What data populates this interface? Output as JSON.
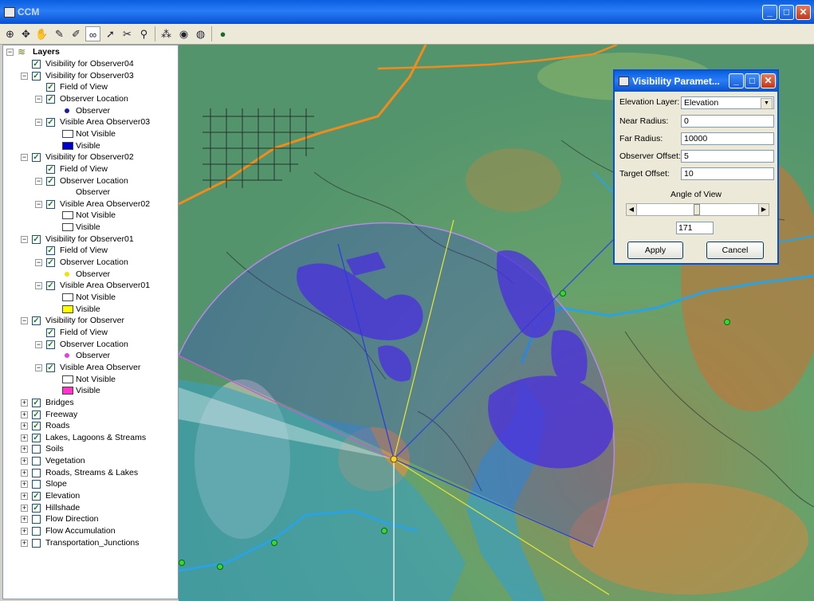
{
  "window": {
    "title": "CCM"
  },
  "toolbar": {
    "icons": [
      "zoom-in-icon",
      "pan-icon",
      "hand-icon",
      "identify-icon",
      "measure-icon",
      "binoculars-icon",
      "arrow-tool-icon",
      "select-tool-icon",
      "observer-icon",
      "network-icon",
      "globe-map-icon",
      "globe-edit-icon",
      "world-icon"
    ]
  },
  "layers": {
    "root": "Layers",
    "rows": [
      {
        "label": "Visibility for Observer04"
      },
      {
        "label": "Visibility for Observer03"
      },
      {
        "label": "Field of View"
      },
      {
        "label": "Observer Location"
      },
      {
        "label": "Observer",
        "color": "#1a1aa8"
      },
      {
        "label": "Visible Area Observer03"
      },
      {
        "label": "Not Visible"
      },
      {
        "label": "Visible",
        "color": "#0000cc"
      },
      {
        "label": "Visibility for Observer02"
      },
      {
        "label": "Field of View"
      },
      {
        "label": "Observer Location"
      },
      {
        "label": "Observer"
      },
      {
        "label": "Visible Area Observer02"
      },
      {
        "label": "Not Visible"
      },
      {
        "label": "Visible"
      },
      {
        "label": "Visibility for Observer01"
      },
      {
        "label": "Field of View"
      },
      {
        "label": "Observer Location"
      },
      {
        "label": "Observer",
        "color": "#f5e000"
      },
      {
        "label": "Visible Area Observer01"
      },
      {
        "label": "Not Visible"
      },
      {
        "label": "Visible",
        "color": "#ffff00"
      },
      {
        "label": "Visibility for Observer"
      },
      {
        "label": "Field of View"
      },
      {
        "label": "Observer Location"
      },
      {
        "label": "Observer",
        "color": "#e040e0"
      },
      {
        "label": "Visible Area Observer"
      },
      {
        "label": "Not Visible"
      },
      {
        "label": "Visible",
        "color": "#ff33cc"
      },
      {
        "label": "Bridges"
      },
      {
        "label": "Freeway"
      },
      {
        "label": "Roads"
      },
      {
        "label": "Lakes, Lagoons & Streams"
      },
      {
        "label": "Soils"
      },
      {
        "label": "Vegetation"
      },
      {
        "label": "Roads, Streams & Lakes"
      },
      {
        "label": "Slope"
      },
      {
        "label": "Elevation"
      },
      {
        "label": "Hillshade"
      },
      {
        "label": "Flow Direction"
      },
      {
        "label": "Flow Accumulation"
      },
      {
        "label": "Transportation_Junctions"
      }
    ]
  },
  "dialog": {
    "title": "Visibility Paramet...",
    "elevation_layer_label": "Elevation Layer:",
    "elevation_layer_value": "Elevation",
    "near_radius_label": "Near Radius:",
    "near_radius_value": "0",
    "far_radius_label": "Far Radius:",
    "far_radius_value": "10000",
    "observer_offset_label": "Observer Offset:",
    "observer_offset_value": "5",
    "target_offset_label": "Target Offset:",
    "target_offset_value": "10",
    "angle_label": "Angle of View",
    "angle_value": "171",
    "angle_fraction": 0.47,
    "apply_label": "Apply",
    "cancel_label": "Cancel"
  },
  "colors": {
    "accent": "#0a5fe0",
    "visible_area": "#3c3cdc",
    "river": "#2aa3e0",
    "freeway": "#f08c1e"
  }
}
